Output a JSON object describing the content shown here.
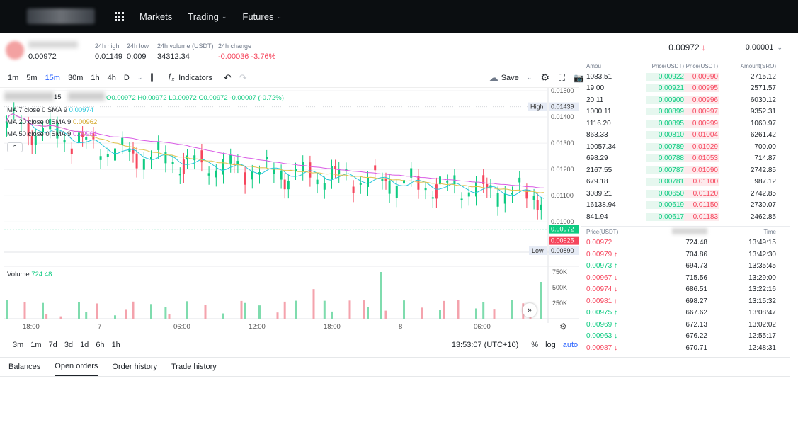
{
  "nav": {
    "links": [
      "Markets",
      "Trading",
      "Futures"
    ]
  },
  "ticker": {
    "last_price": "0.00972",
    "stats": [
      {
        "label": "24h high",
        "value": "0.01149"
      },
      {
        "label": "24h low",
        "value": "0.009"
      },
      {
        "label": "24h volume (USDT)",
        "value": "34312.34"
      },
      {
        "label": "24h change",
        "value": "-0.00036  -3.76%"
      }
    ]
  },
  "toolbar": {
    "intervals": [
      "1m",
      "5m",
      "15m",
      "30m",
      "1h",
      "4h",
      "D"
    ],
    "active_interval": "15m",
    "indicators_label": "Indicators",
    "save_label": "Save"
  },
  "legend": {
    "interval": "15",
    "ohlc": "O0.00972 H0.00972 L0.00972 C0.00972 -0.00007 (-0.72%)",
    "ma7": "MA 7 close 0 SMA 9",
    "ma7_val": "0.00974",
    "ma20": "MA 20 close 0 SMA 9",
    "ma20_val": "0.00962",
    "ma50": "MA 50 close 0 SMA 9",
    "ma50_val": "0.00961",
    "volume_label": "Volume",
    "volume_val": "724.48"
  },
  "axis": {
    "price_ticks": [
      "0.01500",
      "0.01400",
      "0.01300",
      "0.01200",
      "0.01100",
      "0.01000"
    ],
    "high_label": "High",
    "high_val": "0.01439",
    "low_label": "Low",
    "low_val": "0.00890",
    "current_val": "0.00972",
    "current2_val": "0.00925",
    "vol_ticks": [
      "750K",
      "500K",
      "250K"
    ],
    "time_ticks": [
      "18:00",
      "7",
      "06:00",
      "12:00",
      "18:00",
      "8",
      "06:00"
    ]
  },
  "timeframes": [
    "3m",
    "1m",
    "7d",
    "3d",
    "1d",
    "6h",
    "1h"
  ],
  "clock": "13:53:07 (UTC+10)",
  "scale_opts": [
    "%",
    "log",
    "auto"
  ],
  "bottom_tabs": [
    "Balances",
    "Open orders",
    "Order history",
    "Trade history"
  ],
  "active_bottom_tab": "Open orders",
  "orderbook": {
    "mid_price": "0.00972",
    "step": "0.00001",
    "cols": [
      "Amou",
      "Price(USDT)",
      "Price(USDT)",
      "Amount(SRO)"
    ],
    "rows": [
      [
        "1083.51",
        "0.00922",
        "0.00990",
        "2715.12"
      ],
      [
        "19.00",
        "0.00921",
        "0.00995",
        "2571.57"
      ],
      [
        "20.11",
        "0.00900",
        "0.00996",
        "6030.12"
      ],
      [
        "1000.11",
        "0.00899",
        "0.00997",
        "9352.31"
      ],
      [
        "1116.20",
        "0.00895",
        "0.00999",
        "1060.97"
      ],
      [
        "863.33",
        "0.00810",
        "0.01004",
        "6261.42"
      ],
      [
        "10057.34",
        "0.00789",
        "0.01029",
        "700.00"
      ],
      [
        "698.29",
        "0.00788",
        "0.01053",
        "714.87"
      ],
      [
        "2167.55",
        "0.00787",
        "0.01090",
        "2742.85"
      ],
      [
        "679.18",
        "0.00781",
        "0.01100",
        "987.12"
      ],
      [
        "3089.21",
        "0.00650",
        "0.01120",
        "2742.85"
      ],
      [
        "16138.94",
        "0.00619",
        "0.01150",
        "2730.07"
      ],
      [
        "841.94",
        "0.00617",
        "0.01183",
        "2462.85"
      ]
    ]
  },
  "trades": {
    "cols": [
      "Price(USDT)",
      "Time"
    ],
    "rows": [
      {
        "price": "0.00972",
        "dir": "",
        "amount": "724.48",
        "time": "13:49:15",
        "side": "sell"
      },
      {
        "price": "0.00979",
        "dir": "↑",
        "amount": "704.86",
        "time": "13:42:30",
        "side": "sell"
      },
      {
        "price": "0.00973",
        "dir": "↑",
        "amount": "694.73",
        "time": "13:35:45",
        "side": "buy"
      },
      {
        "price": "0.00967",
        "dir": "↓",
        "amount": "715.56",
        "time": "13:29:00",
        "side": "sell"
      },
      {
        "price": "0.00974",
        "dir": "↓",
        "amount": "686.51",
        "time": "13:22:16",
        "side": "sell"
      },
      {
        "price": "0.00981",
        "dir": "↑",
        "amount": "698.27",
        "time": "13:15:32",
        "side": "sell"
      },
      {
        "price": "0.00975",
        "dir": "↑",
        "amount": "667.62",
        "time": "13:08:47",
        "side": "buy"
      },
      {
        "price": "0.00969",
        "dir": "↑",
        "amount": "672.13",
        "time": "13:02:02",
        "side": "buy"
      },
      {
        "price": "0.00963",
        "dir": "↓",
        "amount": "676.22",
        "time": "12:55:17",
        "side": "buy"
      },
      {
        "price": "0.00987",
        "dir": "↓",
        "amount": "670.71",
        "time": "12:48:31",
        "side": "sell"
      }
    ]
  },
  "colors": {
    "up": "#0ecb81",
    "down": "#f6465d",
    "ma7": "#26c6da",
    "ma20": "#e0c14a",
    "ma50": "#d95be5"
  }
}
